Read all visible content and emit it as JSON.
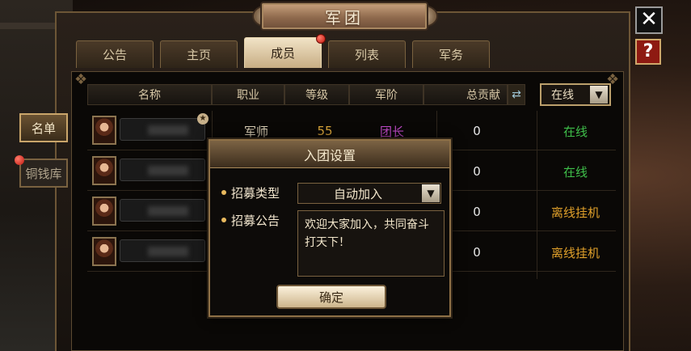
{
  "window": {
    "title": "军团"
  },
  "controls": {
    "close_label": "✕",
    "help_label": "?"
  },
  "tabs": [
    {
      "label": "公告",
      "active": false,
      "badge": false
    },
    {
      "label": "主页",
      "active": false,
      "badge": false
    },
    {
      "label": "成员",
      "active": true,
      "badge": true
    },
    {
      "label": "列表",
      "active": false,
      "badge": false
    },
    {
      "label": "军务",
      "active": false,
      "badge": false
    }
  ],
  "sidebar": {
    "names_label": "名单",
    "bank_label": "铜钱库"
  },
  "table": {
    "headers": {
      "name": "名称",
      "role": "职业",
      "level": "等级",
      "rank": "军阶",
      "contribution": "总贡献"
    },
    "sort_icon": "swap-icon",
    "filter": {
      "value": "在线",
      "arrow": "▼"
    },
    "rows": [
      {
        "role": "军师",
        "level": "55",
        "rank": "团长",
        "contribution": "0",
        "status": "在线",
        "status_type": "online",
        "leader_star": true
      },
      {
        "role": "",
        "level": "",
        "rank": "",
        "contribution": "0",
        "status": "在线",
        "status_type": "online",
        "leader_star": false
      },
      {
        "role": "",
        "level": "",
        "rank": "",
        "contribution": "0",
        "status": "离线挂机",
        "status_type": "idle",
        "leader_star": false
      },
      {
        "role": "",
        "level": "",
        "rank": "",
        "contribution": "0",
        "status": "离线挂机",
        "status_type": "idle",
        "leader_star": false
      }
    ]
  },
  "modal": {
    "title": "入团设置",
    "recruit_type_label": "招募类型",
    "recruit_type_value": "自动加入",
    "recruit_type_arrow": "▼",
    "announcement_label": "招募公告",
    "announcement_text": "欢迎大家加入，共同奋斗打天下！",
    "confirm_label": "确定"
  },
  "colors": {
    "online": "#3fbf4a",
    "idle": "#e0a02a",
    "level": "#d8a43a",
    "rank": "#c04ac8",
    "frame_gold": "#8e7046"
  }
}
